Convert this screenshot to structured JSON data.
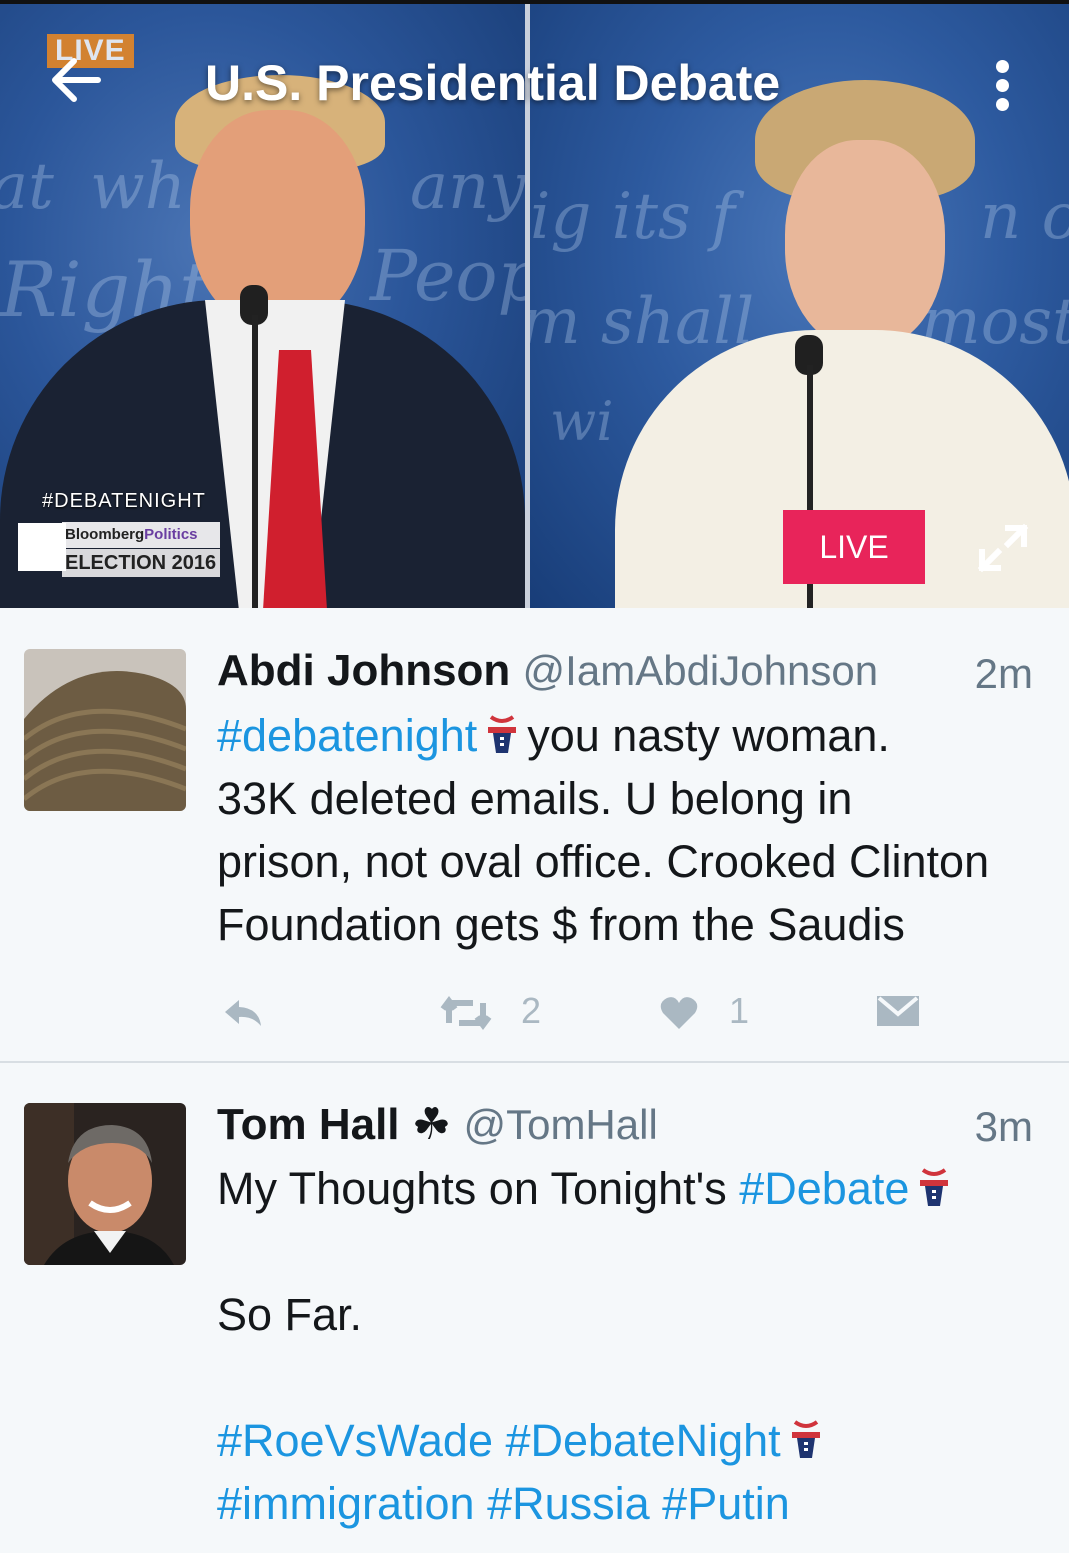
{
  "header": {
    "live_badge": "LIVE",
    "title": "U.S. Presidential Debate"
  },
  "video": {
    "hashtag": "#DEBATENIGHT",
    "broadcaster_line1_a": "Bloomberg",
    "broadcaster_line1_b": "Politics",
    "broadcaster_line2": "ELECTION 2016",
    "live_button": "LIVE",
    "backdrop_words": [
      "at",
      "wh",
      "Right",
      "any",
      "Peo",
      "ig its f",
      "m shall",
      "most",
      "n o",
      "Peop",
      "wi"
    ]
  },
  "colors": {
    "hashtag": "#1b95e0",
    "live_button": "#e8245a",
    "live_badge": "#f08a1f"
  },
  "tweets": [
    {
      "name": "Abdi Johnson",
      "badge": "",
      "handle": "@IamAbdiJohnson",
      "time": "2m",
      "hashtag1": "#debatenight",
      "text1": "you nasty woman.",
      "text2": "33K deleted emails. U belong in",
      "text3": "prison, not oval office. Crooked Clinton",
      "text4": "Foundation gets $ from the Saudis",
      "retweets": "2",
      "likes": "1"
    },
    {
      "name": "Tom Hall",
      "badge": "☘",
      "handle": "@TomHall",
      "time": "3m",
      "text1": "My Thoughts on Tonight's ",
      "hashtag1": "#Debate",
      "text2": "So Far.",
      "hashtags_line1": "#RoeVsWade #DebateNight",
      "hashtags_line2": "#immigration #Russia #Putin"
    }
  ]
}
